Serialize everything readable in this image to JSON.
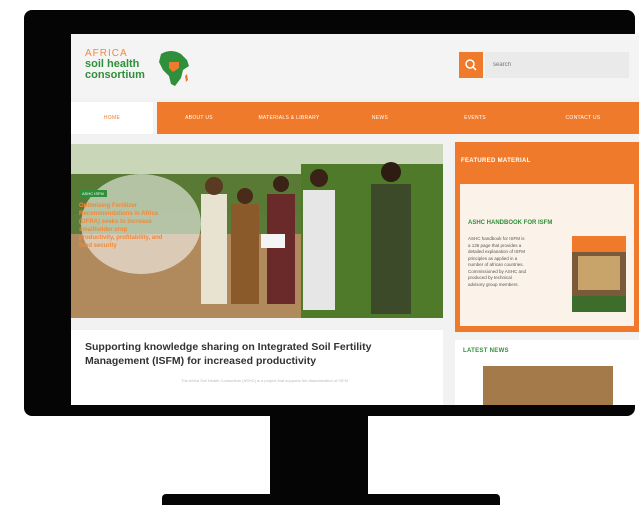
{
  "logo": {
    "line1": "AFRICA",
    "line2": "soil health",
    "line3": "consortium"
  },
  "search": {
    "placeholder": "search"
  },
  "nav": {
    "items": [
      "HOME",
      "ABOUT US",
      "MATERIALS & LIBRARY",
      "NEWS",
      "EVENTS",
      "CONTACT US"
    ],
    "active": "HOME"
  },
  "hero": {
    "badge": "ASHC ISFM",
    "caption_lines": [
      "Optimising Fertilizer",
      "Recommendations in Africa",
      "(OFRA) seeks to increase",
      "smallholder crop",
      "productivity, profitability, and",
      "food security"
    ]
  },
  "featured": {
    "title": "FEATURED MATERIAL",
    "card_title": "ASHC HANDBOOK FOR ISFM",
    "desc_lines": [
      "ASHC handbook for ISFM is",
      "a 136 page that provides a",
      "detailed explanation of ISFM",
      "principles as applied in a",
      "number of african countries.",
      "Commissioned by ASHC and",
      "produced by technical",
      "advisory group members."
    ]
  },
  "main": {
    "heading_lines": [
      "Supporting knowledge sharing on Integrated Soil Fertility",
      "Management (ISFM) for increased productivity"
    ],
    "subtext": "The Africa Soil Health Consortium (ASHC) is a project that supports the dissemination of ISFM"
  },
  "latest": {
    "title": "LATEST NEWS"
  },
  "colors": {
    "accent": "#ef7a2b",
    "brand_green": "#2f8f3a",
    "monitor": "#050505"
  }
}
